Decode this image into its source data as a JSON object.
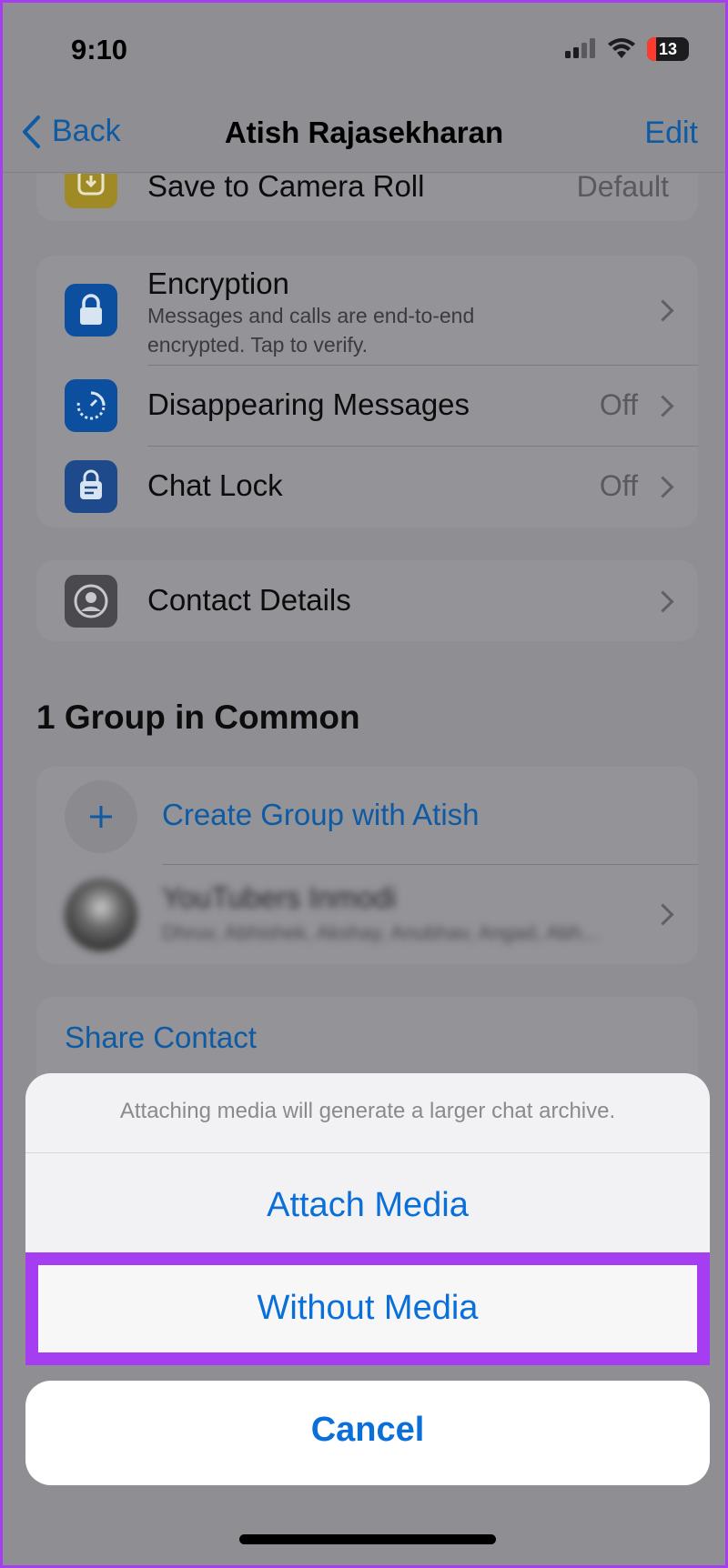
{
  "status": {
    "time": "9:10",
    "battery": "13"
  },
  "nav": {
    "back": "Back",
    "title": "Atish Rajasekharan",
    "edit": "Edit"
  },
  "save_row": {
    "title": "Save to Camera Roll",
    "value": "Default"
  },
  "privacy": {
    "encryption": {
      "title": "Encryption",
      "subtitle_line1": "Messages and calls are end-to-end",
      "subtitle_line2": "encrypted. Tap to verify."
    },
    "disappearing": {
      "title": "Disappearing Messages",
      "value": "Off"
    },
    "chat_lock": {
      "title": "Chat Lock",
      "value": "Off"
    }
  },
  "contact_details": {
    "title": "Contact Details"
  },
  "groups": {
    "header": "1 Group in Common",
    "create": "Create Group with Atish",
    "group_name": "YouTubers Inmodi",
    "group_members": "Dhruv, Abhishek, Akshay, Anubhav, Angad, Abh..."
  },
  "share_contact": "Share Contact",
  "sheet": {
    "message": "Attaching media will generate a larger chat archive.",
    "attach": "Attach Media",
    "without": "Without Media",
    "cancel": "Cancel"
  },
  "colors": {
    "accent": "#0a6fd8",
    "highlight": "#a53df0"
  }
}
